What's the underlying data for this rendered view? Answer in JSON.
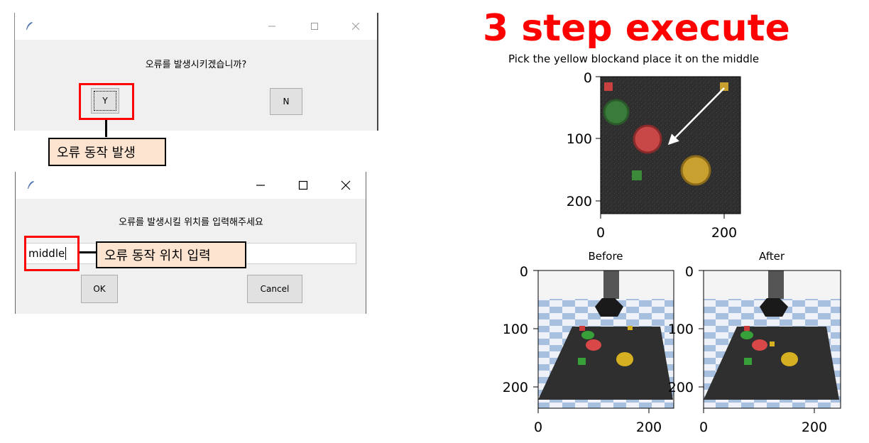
{
  "dialog1": {
    "message": "오류를 발생시키겠습니까?",
    "yes_label": "Y",
    "no_label": "N",
    "callout": "오류 동작 발생"
  },
  "dialog2": {
    "message": "오류를 발생시킬 위치를 입력해주세요",
    "entry_value": "middle",
    "ok_label": "OK",
    "cancel_label": "Cancel",
    "callout": "오류 동작 위치 입력"
  },
  "window_controls": {
    "minimize_icon": "minimize-icon",
    "maximize_icon": "maximize-icon",
    "close_icon": "close-icon",
    "app_icon": "feather-icon"
  },
  "figure": {
    "title": "3 step execute",
    "title_color": "#ff0000",
    "top_plot_title": "Pick the yellow blockand place it on the middle",
    "top_plot": {
      "x_ticks": [
        "0",
        "200"
      ],
      "y_ticks": [
        "0",
        "100",
        "200"
      ]
    },
    "before_title": "Before",
    "after_title": "After",
    "bottom_plot": {
      "x_ticks": [
        "0",
        "200"
      ],
      "y_ticks": [
        "0",
        "100",
        "200"
      ]
    }
  }
}
